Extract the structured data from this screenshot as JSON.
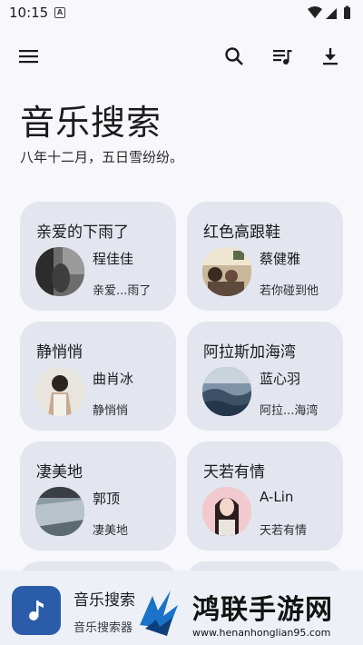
{
  "status_bar": {
    "time": "10:15",
    "notification_icon": "A"
  },
  "appbar": {
    "menu_icon": "menu-icon",
    "search_icon": "search-icon",
    "queue_icon": "queue-music-icon",
    "download_icon": "download-icon"
  },
  "header": {
    "title": "音乐搜索",
    "subtitle": "八年十二月，五日雪纷纷。"
  },
  "songs": [
    {
      "title": "亲爱的下雨了",
      "artist": "程佳佳",
      "album": "亲爱...雨了"
    },
    {
      "title": "红色高跟鞋",
      "artist": "蔡健雅",
      "album": "若你碰到他"
    },
    {
      "title": "静悄悄",
      "artist": "曲肖冰",
      "album": "静悄悄"
    },
    {
      "title": "阿拉斯加海湾",
      "artist": "蓝心羽",
      "album": "阿拉...海湾"
    },
    {
      "title": "凄美地",
      "artist": "郭顶",
      "album": "凄美地"
    },
    {
      "title": "天若有情",
      "artist": "A-Lin",
      "album": "天若有情"
    }
  ],
  "player": {
    "title": "音乐搜索",
    "subtitle": "音乐搜索器"
  },
  "watermark": {
    "text": "鸿联手游网",
    "url": "www.henanhonglian95.com"
  },
  "colors": {
    "card_bg": "#e3e5ef",
    "page_bg": "#f8f8fc",
    "player_art": "#2a5caa"
  }
}
